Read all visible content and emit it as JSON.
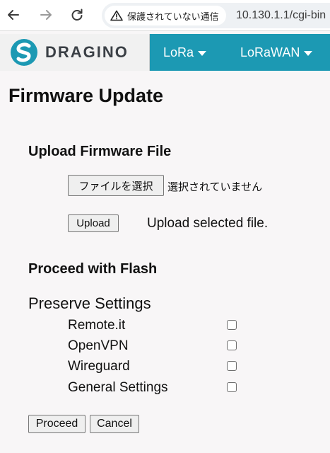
{
  "browser": {
    "security_label": "保護されていない通信",
    "url": "10.130.1.1/cgi-bin"
  },
  "navbar": {
    "brand": "DRAGINO",
    "menus": [
      {
        "label": "LoRa"
      },
      {
        "label": "LoRaWAN"
      }
    ]
  },
  "page": {
    "title": "Firmware Update",
    "upload": {
      "heading": "Upload Firmware File",
      "choose_file_label": "ファイルを選択",
      "file_status": "選択されていません",
      "upload_label": "Upload",
      "upload_help": "Upload selected file."
    },
    "flash": {
      "heading": "Proceed with Flash",
      "preserve_label": "Preserve Settings",
      "options": [
        {
          "label": "Remote.it",
          "checked": false
        },
        {
          "label": "OpenVPN",
          "checked": false
        },
        {
          "label": "Wireguard",
          "checked": false
        },
        {
          "label": "General Settings",
          "checked": false
        }
      ],
      "proceed_label": "Proceed",
      "cancel_label": "Cancel"
    }
  },
  "colors": {
    "navbar_bg": "#1c99b3",
    "brand_bg": "#f1f1f1",
    "page_bg": "#f8f6f7"
  },
  "icons": [
    "back-arrow-icon",
    "forward-arrow-icon",
    "reload-icon",
    "warning-icon",
    "dragino-logo-icon",
    "caret-down-icon"
  ]
}
